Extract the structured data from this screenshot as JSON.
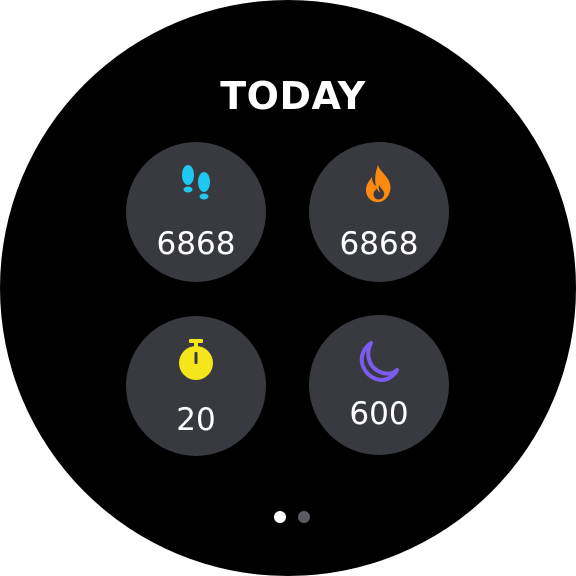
{
  "title": "TODAY",
  "tiles": [
    {
      "id": "steps",
      "icon": "footsteps-icon",
      "value": "6868",
      "color": "#1ec8f0"
    },
    {
      "id": "calories",
      "icon": "flame-icon",
      "value": "6868",
      "color": "#ff8a10"
    },
    {
      "id": "timer",
      "icon": "stopwatch-icon",
      "value": "20",
      "color": "#f5e61c"
    },
    {
      "id": "sleep",
      "icon": "moon-icon",
      "value": "600",
      "color": "#7c5cf0"
    }
  ],
  "pagination": {
    "current": 1,
    "total": 2,
    "active_color": "#ffffff",
    "inactive_color": "#5a5c62"
  },
  "colors": {
    "background": "#000000",
    "tile": "#383a40",
    "text": "#ffffff"
  }
}
